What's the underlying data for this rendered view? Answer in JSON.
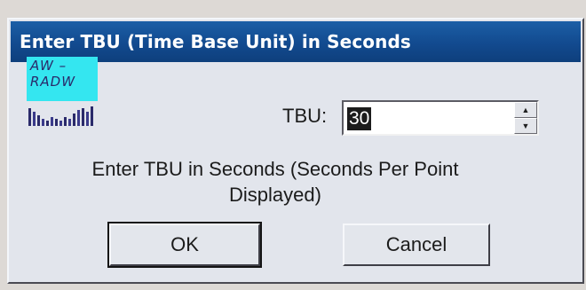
{
  "dialog": {
    "title": "Enter TBU (Time Base Unit) in Seconds",
    "title_bar_color": "#124a8f",
    "app_icon": {
      "name": "aw-radw-icon",
      "text_line1": "AW –",
      "text_line2": "RADW",
      "background_color": "#34e6f0"
    },
    "tbu": {
      "label": "TBU:",
      "value": "30",
      "spinner_up_icon": "spin-up-arrow-icon",
      "spinner_down_icon": "spin-down-arrow-icon"
    },
    "hint": "Enter TBU in Seconds (Seconds Per Point Displayed)",
    "buttons": {
      "ok": "OK",
      "cancel": "Cancel"
    }
  }
}
